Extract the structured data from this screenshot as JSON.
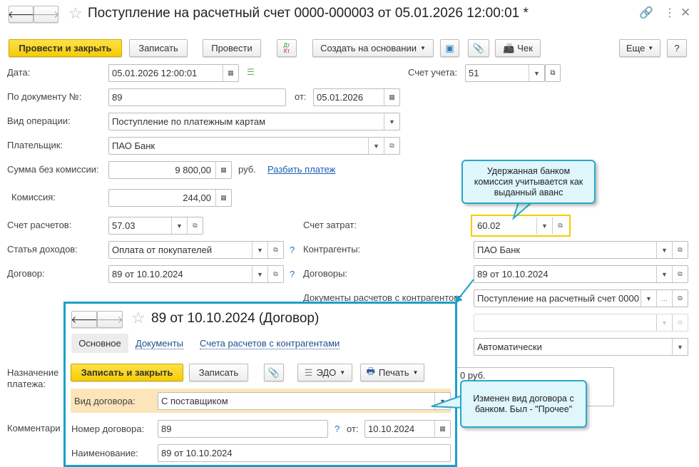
{
  "header": {
    "title": "Поступление на расчетный счет 0000-000003 от 05.01.2026 12:00:01 *"
  },
  "toolbar": {
    "post_close": "Провести и закрыть",
    "save": "Записать",
    "post": "Провести",
    "dtkt_dt": "Дт",
    "dtkt_kt": "Кт",
    "create_based": "Создать на основании",
    "check": "Чек",
    "more": "Еще",
    "help": "?"
  },
  "form": {
    "date_label": "Дата:",
    "date": "05.01.2026 12:00:01",
    "account_label": "Счет учета:",
    "account": "51",
    "doc_label": "По документу №:",
    "doc_no": "89",
    "doc_from_label": "от:",
    "doc_date": "05.01.2026",
    "op_label": "Вид операции:",
    "op": "Поступление по платежным картам",
    "payer_label": "Плательщик:",
    "payer": "ПАО Банк",
    "sum_label": "Сумма без комиссии:",
    "sum": "9 800,00",
    "currency": "руб.",
    "split_link": "Разбить платеж",
    "fee_label": "Комиссия:",
    "fee": "244,00",
    "settle_label": "Счет расчетов:",
    "settle": "57.03",
    "cost_label": "Счет затрат:",
    "cost": "60.02",
    "income_label": "Статья доходов:",
    "income": "Оплата от покупателей",
    "contractors_label": "Контрагенты:",
    "contractors": "ПАО Банк",
    "contract_label": "Договор:",
    "contract": "89 от 10.10.2024",
    "contracts_label": "Договоры:",
    "contracts": "89 от 10.10.2024",
    "docs_label": "Документы расчетов с контрагентом:",
    "docs": "Поступление на расчетный счет 0000",
    "empty_field": "",
    "auto": "Автоматически",
    "purpose_label_1": "Назначение",
    "purpose_label_2": "платежа:",
    "purpose": "0 руб.",
    "comment_label": "Комментари",
    "help_mark": "?"
  },
  "callouts": {
    "first": "Удержанная банком комиссия учитывается как выданный аванс",
    "second": "Изменен вид договора с банком. Был - \"Прочее\""
  },
  "popup": {
    "title": "89 от 10.10.2024 (Договор)",
    "tabs": [
      "Основное",
      "Документы",
      "Счета расчетов с контрагентами"
    ],
    "save_close": "Записать и закрыть",
    "save": "Записать",
    "edo": "ЭДО",
    "print": "Печать",
    "kind_label": "Вид договора:",
    "kind": "С поставщиком",
    "number_label": "Номер договора:",
    "number": "89",
    "from_label": "от:",
    "date": "10.10.2024",
    "help_mark": "?",
    "name_label": "Наименование:",
    "name": "89 от 10.10.2024"
  },
  "colors": {
    "accent_yellow": "#f5cc00",
    "callout_border": "#2aa7c9",
    "highlight": "#fbe5b9"
  }
}
